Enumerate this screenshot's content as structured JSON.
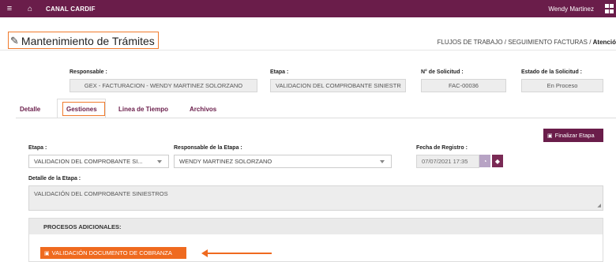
{
  "topbar": {
    "menu_icon": "hamburger-icon",
    "home_icon": "home-icon",
    "brand": "CANAL CARDIF",
    "user": "Wendy Martinez",
    "apps_icon": "grid-icon",
    "bg_color": "#6a1d4a"
  },
  "header": {
    "title": "Mantenimiento de Trámites",
    "title_icon": "edit-icon",
    "breadcrumb_path": "FLUJOS DE TRABAJO / SEGUIMIENTO FACTURAS / ",
    "breadcrumb_current": "Atenció"
  },
  "summary": {
    "responsable_label": "Responsable :",
    "responsable_value": "GEX - FACTURACION - WENDY MARTINEZ SOLORZANO",
    "etapa_label": "Etapa :",
    "etapa_value": "VALIDACION DEL COMPROBANTE SINIESTR",
    "solicitud_label": "N° de Solicitud :",
    "solicitud_value": "FAC-00036",
    "estado_label": "Estado de la Solicitud :",
    "estado_value": "En Proceso"
  },
  "tabs": [
    "Detalle",
    "Gestiones",
    "Linea de Tiempo",
    "Archivos"
  ],
  "active_tab": "Gestiones",
  "gestiones": {
    "finalize_label": "Finalizar Etapa",
    "etapa_label": "Etapa :",
    "etapa_value": "VALIDACION DEL COMPROBANTE SI...",
    "responsable_label": "Responsable de la Etapa :",
    "responsable_value": "WENDY MARTINEZ SOLORZANO",
    "fecha_label": "Fecha de Registro :",
    "fecha_value": "07/07/2021 17:35",
    "detalle_label": "Detalle de la Etapa :",
    "detalle_value": "VALIDACIÓN DEL COMPROBANTE SINIESTROS",
    "procesos_header": "PROCESOS ADICIONALES:",
    "doc_button": "VALIDACIÓN DOCUMENTO DE COBRANZA"
  },
  "colors": {
    "primary": "#6a1d4a",
    "highlight": "#f07a2c",
    "action": "#ef6a1f",
    "date_btn_1": "#b7a3c4",
    "date_btn_2": "#7a2a55"
  }
}
